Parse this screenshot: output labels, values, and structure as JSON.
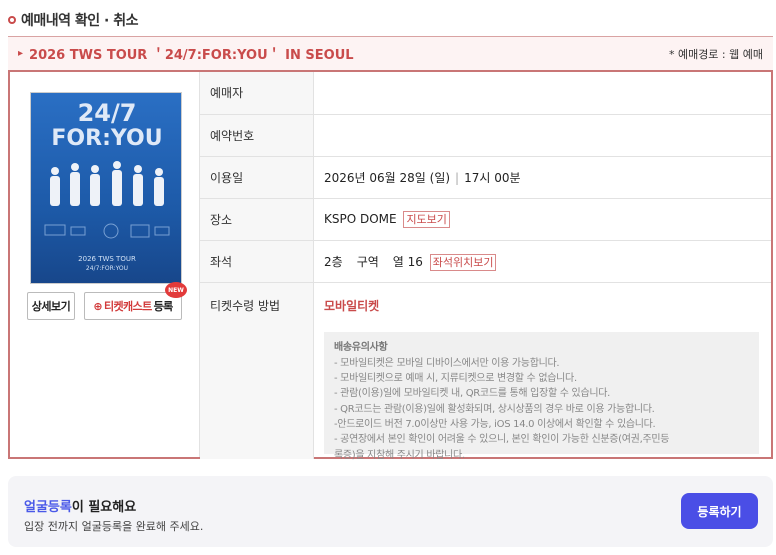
{
  "header": {
    "title": "예매내역 확인 · 취소"
  },
  "event": {
    "title": "2026 TWS TOUR ＇24/7:FOR:YOU＇ IN SEOUL",
    "route_note": "* 예매경로 : 웹 예매"
  },
  "poster": {
    "headline1": "24/7",
    "headline2": "FOR:YOU",
    "caption1": "2026 TWS TOUR",
    "caption2": "24/7:FOR:YOU"
  },
  "buttons": {
    "detail": "상세보기",
    "ticketcast_name": "티켓캐스트",
    "ticketcast_suffix": "등록",
    "new_badge": "NEW"
  },
  "info": {
    "booker_label": "예매자",
    "booker_value": "",
    "reservation_label": "예약번호",
    "reservation_value": "",
    "date_label": "이용일",
    "date_value": "2026년 06월 28일 (일)",
    "time_value": "17시 00분",
    "venue_label": "장소",
    "venue_value": "KSPO DOME",
    "map_link": "지도보기",
    "seat_label": "좌석",
    "seat_floor": "2층",
    "seat_zone": "구역",
    "seat_row": "열 16",
    "seat_map_link": "좌석위치보기",
    "receive_label": "티켓수령 방법",
    "receive_value": "모바일티켓"
  },
  "notice": {
    "title": "배송유의사항",
    "lines": [
      "- 모바일티켓은 모바일 디바이스에서만 이용 가능합니다.",
      "- 모바일티켓으로 예매 시, 지류티켓으로 변경할 수 없습니다.",
      "- 관람(이용)일에 모바일티켓 내, QR코드를 통해 입장할 수 있습니다.",
      "- QR코드는 관람(이용)일에 활성화되며, 상시상품의 경우 바로 이용 가능합니다.",
      "-안드로이드 버전 7.0이상만 사용 가능, iOS 14.0 이상에서 확인할 수 있습니다.",
      "- 공연장에서 본인 확인이 어려울 수 있으니, 본인 확인이 가능한 신분증(여권,주민등",
      "록증)을 지참해 주시기 바랍니다."
    ]
  },
  "face": {
    "title_highlight": "얼굴등록",
    "title_rest": "이 필요해요",
    "desc": "입장 전까지 얼굴등록을 완료해 주세요.",
    "button": "등록하기"
  },
  "colors": {
    "accent": "#c94b4b",
    "primary_button": "#4a4ee6",
    "poster_bg": "#1f5fae"
  },
  "icons": {
    "header_bullet": "ring-icon",
    "event_arrow": "arrow-right-icon",
    "ticketcast": "add-card-icon"
  }
}
